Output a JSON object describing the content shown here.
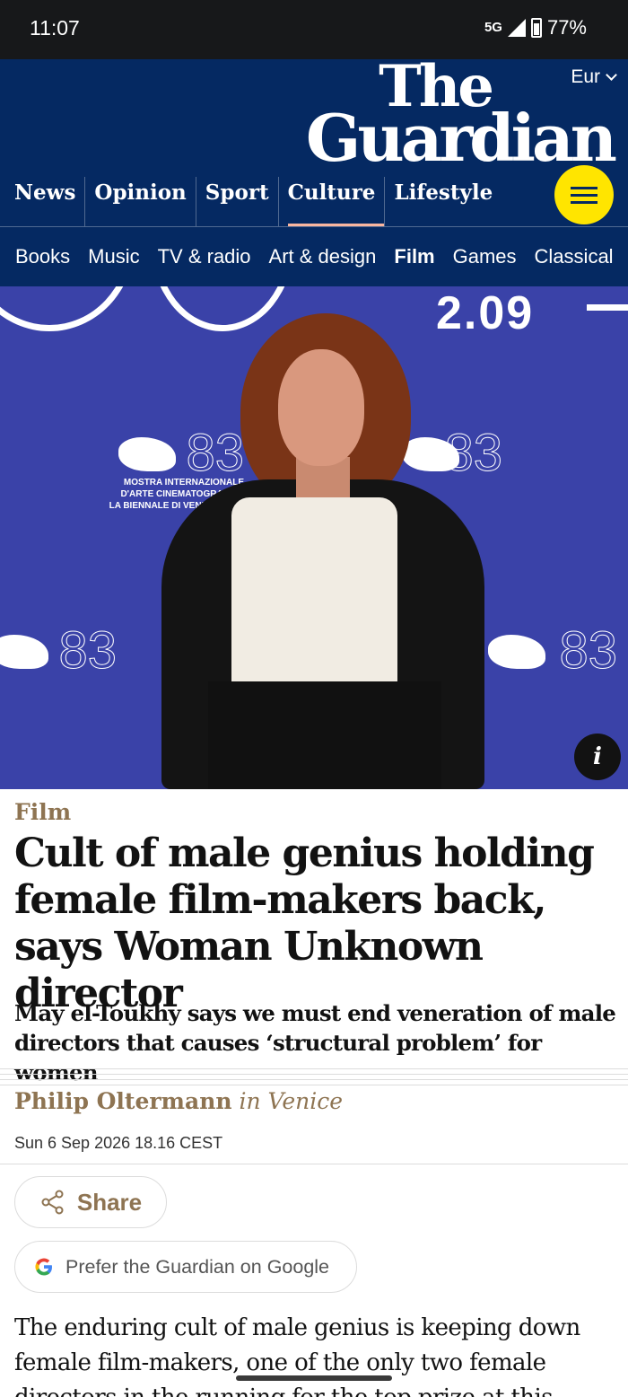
{
  "status_bar": {
    "time": "11:07",
    "network": "5G",
    "battery": "77%"
  },
  "header": {
    "edition": "Eur",
    "logo_line1": "The",
    "logo_line2": "Guardian",
    "pillars": [
      "News",
      "Opinion",
      "Sport",
      "Culture",
      "Lifestyle"
    ],
    "active_pillar": "Culture",
    "subnav": [
      "Books",
      "Music",
      "TV & radio",
      "Art & design",
      "Film",
      "Games",
      "Classical"
    ],
    "active_subnav": "Film"
  },
  "hero": {
    "backdrop_date": "2.09",
    "festival_number": "83",
    "festival_caption": [
      "MOSTRA INTERNAZIONALE",
      "D'ARTE CINEMATOGRAFICA",
      "LA BIENNALE DI VENEZIA 2026"
    ],
    "info_label": "i"
  },
  "article": {
    "kicker": "Film",
    "headline": "Cult of male genius holding female film-makers back, says Woman Unknown director",
    "standfirst": "May el-Toukhy says we must end veneration of male directors that causes ‘structural problem’ for women",
    "author": "Philip Oltermann",
    "location": "in Venice",
    "date": "Sun 6 Sep 2026 18.16 CEST",
    "share_label": "Share",
    "google_label": "Prefer the Guardian on Google",
    "body": "The enduring cult of male genius is keeping down female film-makers, one of the only two female directors in the running for the top prize at this"
  },
  "colors": {
    "brand_blue": "#052962",
    "culture": "#8e7452",
    "menu_yellow": "#ffe500",
    "culture_underline": "#fab6a0"
  }
}
